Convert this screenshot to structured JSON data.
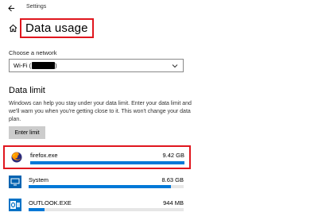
{
  "window": {
    "app_title": "Settings"
  },
  "page": {
    "title": "Data usage"
  },
  "network": {
    "label": "Choose a network",
    "selected": "Wi-Fi (",
    "selected_suffix": ")"
  },
  "data_limit": {
    "section_title": "Data limit",
    "description": "Windows can help you stay under your data limit. Enter your data limit and we'll warn you when you're getting close to it. This won't change your data plan.",
    "button_label": "Enter limit"
  },
  "apps": [
    {
      "name": "firefox.exe",
      "size": "9.42 GB",
      "usage_fraction": 1.0,
      "icon": "firefox-icon"
    },
    {
      "name": "System",
      "size": "8.63 GB",
      "usage_fraction": 0.92,
      "icon": "system-icon"
    },
    {
      "name": "OUTLOOK.EXE",
      "size": "944 MB",
      "usage_fraction": 0.1,
      "icon": "outlook-icon"
    }
  ],
  "colors": {
    "accent": "#0078d7",
    "highlight_border": "#e0161e",
    "button_bg": "#cccccc"
  }
}
